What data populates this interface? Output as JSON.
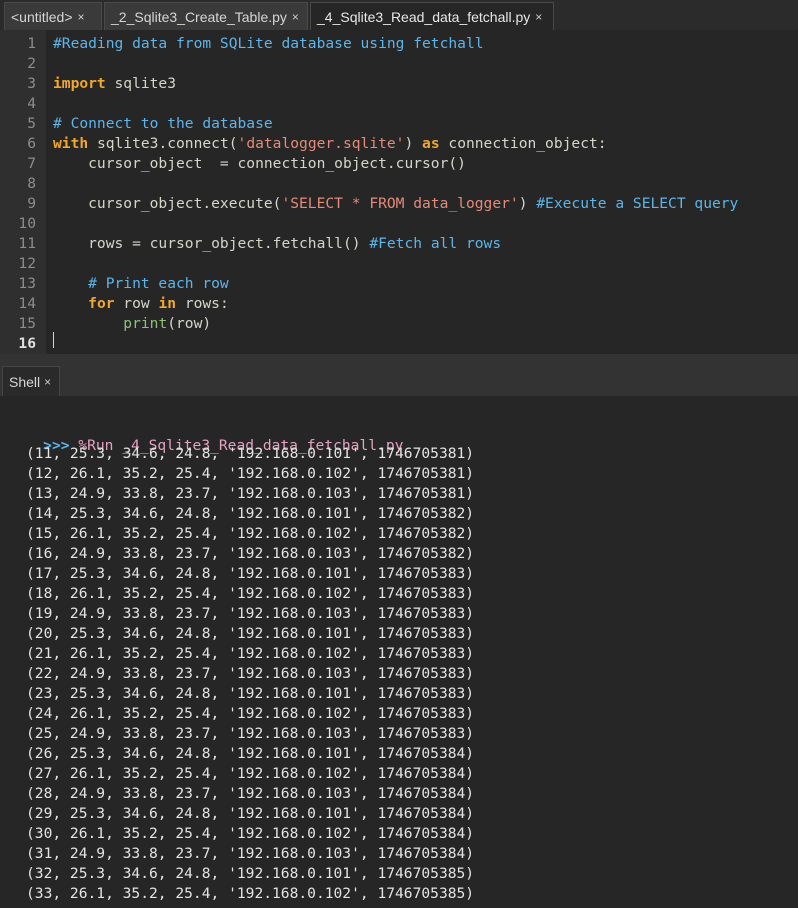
{
  "tabs": [
    {
      "label": "<untitled>",
      "close": "×"
    },
    {
      "label": "_2_Sqlite3_Create_Table.py",
      "close": "×"
    },
    {
      "label": "_4_Sqlite3_Read_data_fetchall.py",
      "close": "×"
    }
  ],
  "editor": {
    "line_numbers": [
      "1",
      "2",
      "3",
      "4",
      "5",
      "6",
      "7",
      "8",
      "9",
      "10",
      "11",
      "12",
      "13",
      "14",
      "15",
      "16"
    ],
    "current_line": "16"
  },
  "shell": {
    "tab_label": "Shell",
    "tab_close": "×",
    "prompt": ">>>",
    "command": "%Run _4_Sqlite3_Read_data_fetchall.py",
    "output": [
      "(11, 25.3, 34.6, 24.8, '192.168.0.101', 1746705381)",
      "(12, 26.1, 35.2, 25.4, '192.168.0.102', 1746705381)",
      "(13, 24.9, 33.8, 23.7, '192.168.0.103', 1746705381)",
      "(14, 25.3, 34.6, 24.8, '192.168.0.101', 1746705382)",
      "(15, 26.1, 35.2, 25.4, '192.168.0.102', 1746705382)",
      "(16, 24.9, 33.8, 23.7, '192.168.0.103', 1746705382)",
      "(17, 25.3, 34.6, 24.8, '192.168.0.101', 1746705383)",
      "(18, 26.1, 35.2, 25.4, '192.168.0.102', 1746705383)",
      "(19, 24.9, 33.8, 23.7, '192.168.0.103', 1746705383)",
      "(20, 25.3, 34.6, 24.8, '192.168.0.101', 1746705383)",
      "(21, 26.1, 35.2, 25.4, '192.168.0.102', 1746705383)",
      "(22, 24.9, 33.8, 23.7, '192.168.0.103', 1746705383)",
      "(23, 25.3, 34.6, 24.8, '192.168.0.101', 1746705383)",
      "(24, 26.1, 35.2, 25.4, '192.168.0.102', 1746705383)",
      "(25, 24.9, 33.8, 23.7, '192.168.0.103', 1746705383)",
      "(26, 25.3, 34.6, 24.8, '192.168.0.101', 1746705384)",
      "(27, 26.1, 35.2, 25.4, '192.168.0.102', 1746705384)",
      "(28, 24.9, 33.8, 23.7, '192.168.0.103', 1746705384)",
      "(29, 25.3, 34.6, 24.8, '192.168.0.101', 1746705384)",
      "(30, 26.1, 35.2, 25.4, '192.168.0.102', 1746705384)",
      "(31, 24.9, 33.8, 23.7, '192.168.0.103', 1746705384)",
      "(32, 25.3, 34.6, 24.8, '192.168.0.101', 1746705385)",
      "(33, 26.1, 35.2, 25.4, '192.168.0.102', 1746705385)"
    ]
  },
  "code": {
    "l1_comment": "#Reading data from SQLite database using fetchall",
    "l3_kw": "import",
    "l3_rest": " sqlite3",
    "l5_comment": "# Connect to the database",
    "l6_kw_with": "with",
    "l6_a": " sqlite3.connect(",
    "l6_str": "'datalogger.sqlite'",
    "l6_b": ") ",
    "l6_kw_as": "as",
    "l6_c": " connection_object:",
    "l7_text": "    cursor_object  = connection_object.cursor()",
    "l9_a": "    cursor_object.execute(",
    "l9_str": "'SELECT * FROM data_logger'",
    "l9_b": ") ",
    "l9_comment": "#Execute a SELECT query",
    "l11_a": "    rows = cursor_object.fetchall() ",
    "l11_comment": "#Fetch all rows",
    "l13_comment": "    # Print each row",
    "l14_indent": "    ",
    "l14_kw_for": "for",
    "l14_a": " row ",
    "l14_kw_in": "in",
    "l14_b": " rows:",
    "l15_indent": "        ",
    "l15_bi": "print",
    "l15_a": "(row)"
  },
  "colors": {
    "comment": "#5fb4e8",
    "keyword": "#f0a730",
    "string": "#e58b79",
    "builtin": "#8ec07c",
    "background": "#262626"
  }
}
